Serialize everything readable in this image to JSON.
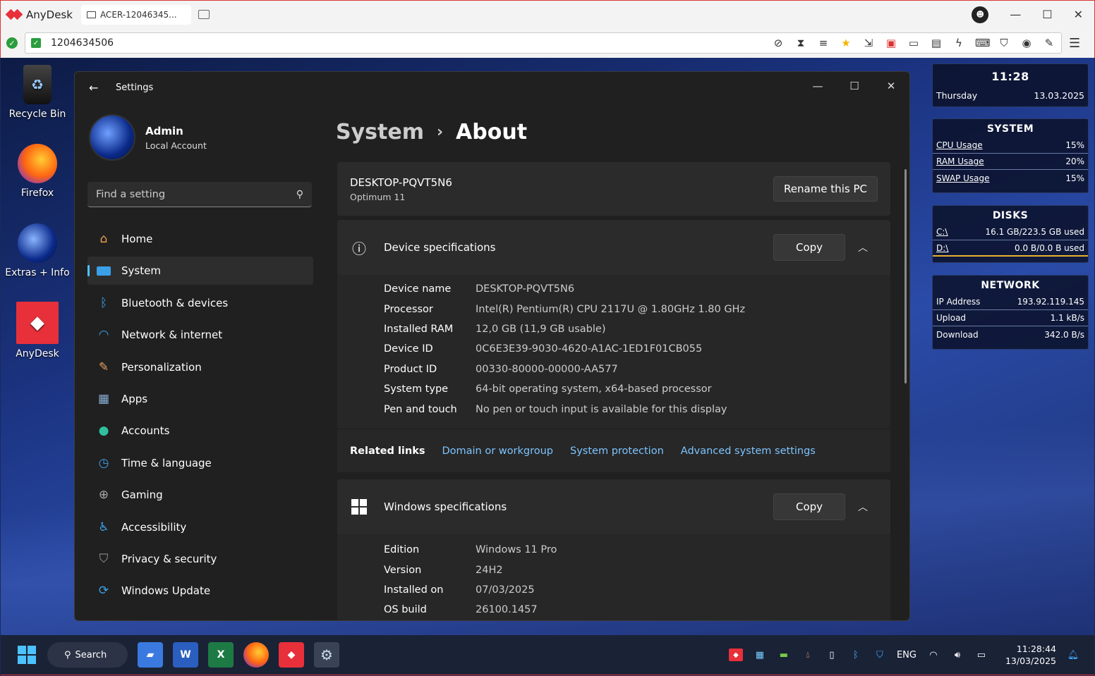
{
  "anydesk": {
    "app_name": "AnyDesk",
    "tab_label": "ACER-12046345...",
    "address": "1204634506",
    "icons": [
      "eye-off-icon",
      "hourglass-icon",
      "database-icon",
      "star-icon",
      "file-transfer-icon",
      "display-icon",
      "monitor-icon",
      "chat-icon",
      "lightning-icon",
      "keyboard-icon",
      "shield-icon",
      "record-icon",
      "pen-icon"
    ],
    "colors": {
      "brand": "#e8303a",
      "secure": "#2a9d3e"
    }
  },
  "desktop_icons": [
    {
      "label": "Recycle Bin"
    },
    {
      "label": "Firefox"
    },
    {
      "label": "Extras + Info"
    },
    {
      "label": "AnyDesk"
    }
  ],
  "settings": {
    "window_title": "Settings",
    "profile": {
      "name": "Admin",
      "account_type": "Local Account"
    },
    "search_placeholder": "Find a setting",
    "nav": [
      {
        "label": "Home",
        "icon": "home-icon"
      },
      {
        "label": "System",
        "icon": "display-icon",
        "active": true
      },
      {
        "label": "Bluetooth & devices",
        "icon": "bluetooth-icon"
      },
      {
        "label": "Network & internet",
        "icon": "wifi-icon"
      },
      {
        "label": "Personalization",
        "icon": "brush-icon"
      },
      {
        "label": "Apps",
        "icon": "apps-icon"
      },
      {
        "label": "Accounts",
        "icon": "person-icon"
      },
      {
        "label": "Time & language",
        "icon": "clock-globe-icon"
      },
      {
        "label": "Gaming",
        "icon": "gamepad-icon"
      },
      {
        "label": "Accessibility",
        "icon": "accessibility-icon"
      },
      {
        "label": "Privacy & security",
        "icon": "shield-icon"
      },
      {
        "label": "Windows Update",
        "icon": "update-icon"
      }
    ],
    "breadcrumb": {
      "parent": "System",
      "current": "About"
    },
    "pc": {
      "name": "DESKTOP-PQVT5N6",
      "model": "Optimum 11",
      "rename_label": "Rename this PC"
    },
    "device_specs": {
      "title": "Device specifications",
      "copy_label": "Copy",
      "rows": [
        {
          "k": "Device name",
          "v": "DESKTOP-PQVT5N6"
        },
        {
          "k": "Processor",
          "v": "Intel(R) Pentium(R) CPU 2117U @ 1.80GHz   1.80 GHz"
        },
        {
          "k": "Installed RAM",
          "v": "12,0 GB (11,9 GB usable)"
        },
        {
          "k": "Device ID",
          "v": "0C6E3E39-9030-4620-A1AC-1ED1F01CB055"
        },
        {
          "k": "Product ID",
          "v": "00330-80000-00000-AA577"
        },
        {
          "k": "System type",
          "v": "64-bit operating system, x64-based processor"
        },
        {
          "k": "Pen and touch",
          "v": "No pen or touch input is available for this display"
        }
      ]
    },
    "related": {
      "label": "Related links",
      "links": [
        "Domain or workgroup",
        "System protection",
        "Advanced system settings"
      ]
    },
    "win_specs": {
      "title": "Windows specifications",
      "copy_label": "Copy",
      "rows": [
        {
          "k": "Edition",
          "v": "Windows 11 Pro"
        },
        {
          "k": "Version",
          "v": "24H2"
        },
        {
          "k": "Installed on",
          "v": "07/03/2025"
        },
        {
          "k": "OS build",
          "v": "26100.1457"
        }
      ]
    }
  },
  "widgets": {
    "clock": {
      "time": "11:28",
      "day": "Thursday",
      "date": "13.03.2025"
    },
    "system": {
      "title": "SYSTEM",
      "rows": [
        {
          "l": "CPU Usage",
          "v": "15%"
        },
        {
          "l": "RAM Usage",
          "v": "20%"
        },
        {
          "l": "SWAP Usage",
          "v": "15%"
        }
      ]
    },
    "disks": {
      "title": "DISKS",
      "rows": [
        {
          "l": "C:\\",
          "v": "16.1 GB/223.5 GB used"
        },
        {
          "l": "D:\\",
          "v": "0.0 B/0.0 B used"
        }
      ]
    },
    "network": {
      "title": "NETWORK",
      "rows": [
        {
          "l": "IP Address",
          "v": "193.92.119.145"
        },
        {
          "l": "Upload",
          "v": "1.1 kB/s"
        },
        {
          "l": "Download",
          "v": "342.0 B/s"
        }
      ]
    }
  },
  "taskbar": {
    "search_label": "Search",
    "language": "ENG",
    "time": "11:28:44",
    "date": "13/03/2025"
  }
}
